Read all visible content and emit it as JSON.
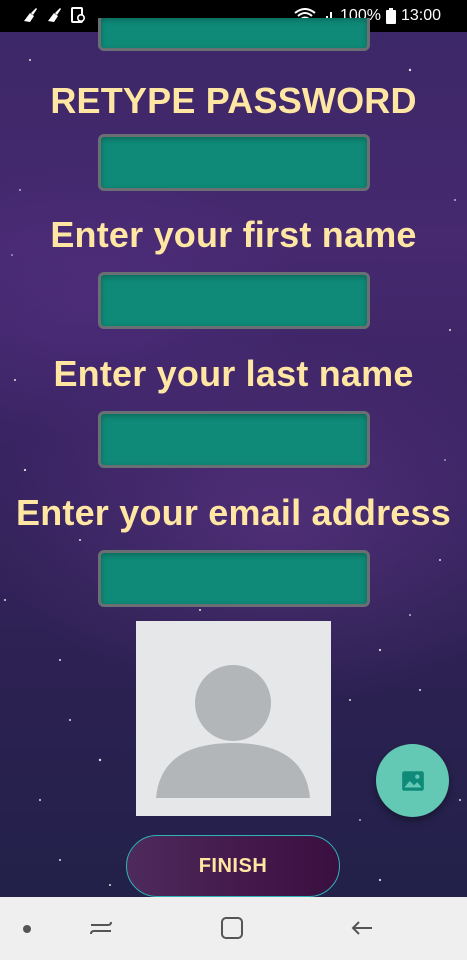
{
  "status_bar": {
    "battery_percent": "100%",
    "time": "13:00",
    "icons": [
      "broom-icon",
      "broom-icon",
      "screenshot-icon",
      "wifi-icon",
      "signal-icon",
      "battery-icon"
    ]
  },
  "form": {
    "labels": {
      "retype_password": "RETYPE PASSWORD",
      "first_name": "Enter your first name",
      "last_name": "Enter your last name",
      "email": "Enter your email address"
    },
    "values": {
      "password_top": "",
      "retype_password": "",
      "first_name": "",
      "last_name": "",
      "email": ""
    },
    "finish_label": "FINISH",
    "avatar_icon": "user-placeholder-icon",
    "fab_icon": "image-icon"
  },
  "nav_bar": {
    "icons": [
      "dot-icon",
      "recent-apps-icon",
      "home-icon",
      "back-icon"
    ]
  },
  "colors": {
    "label_text": "#ffe7a3",
    "field_fill": "#0f8a78",
    "field_border": "#6a6f73",
    "fab": "#63c9b4",
    "finish_border": "#2fb3b8",
    "finish_fill": "#43184a"
  }
}
